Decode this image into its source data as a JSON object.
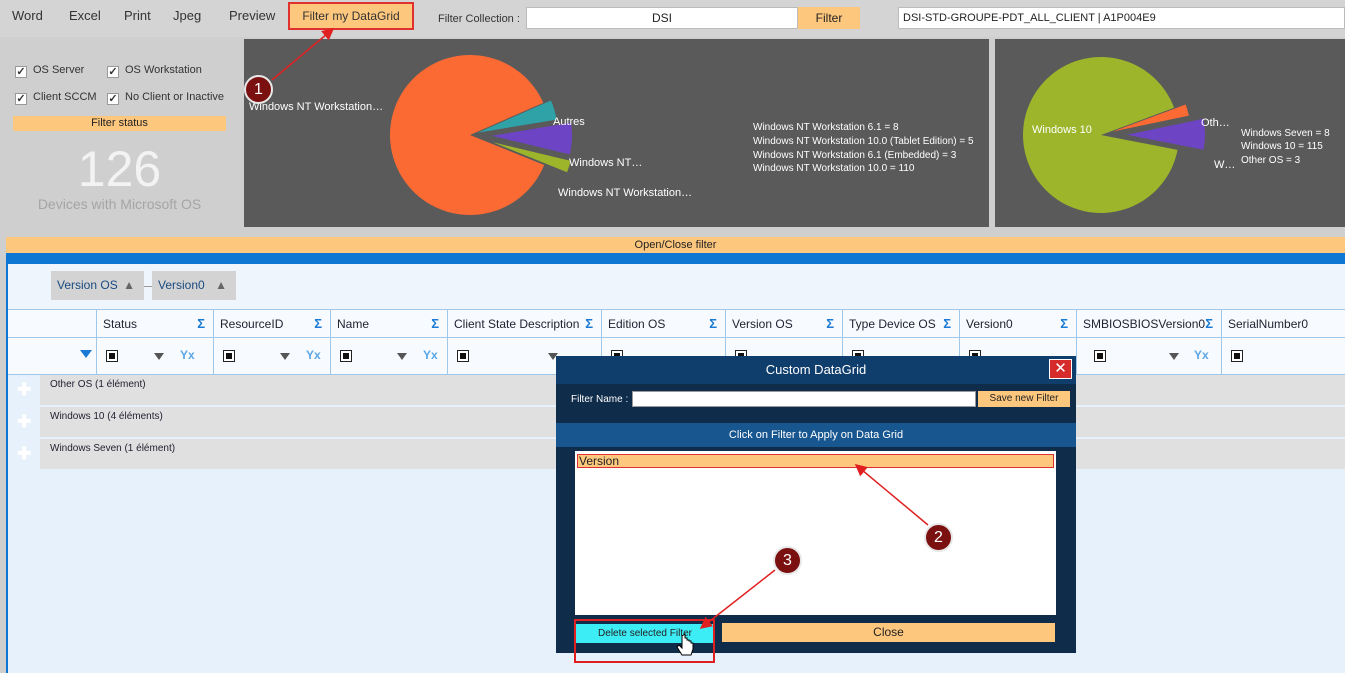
{
  "toolbar": {
    "word": "Word",
    "excel": "Excel",
    "print": "Print",
    "jpeg": "Jpeg",
    "preview": "Preview",
    "filter_grid": "Filter my DataGrid",
    "filter_collection_label": "Filter Collection :",
    "filter_collection_value": "DSI",
    "filter_button": "Filter",
    "collection_select": "DSI-STD-GROUPE-PDT_ALL_CLIENT  |  A1P004E9"
  },
  "options": {
    "os_server": "OS Server",
    "os_workstation": "OS Workstation",
    "client_sccm": "Client SCCM",
    "no_client": "No Client or Inactive",
    "filter_status": "Filter status",
    "count": "126",
    "count_label": "Devices with Microsoft OS"
  },
  "colors": {
    "orange": "#fc6a34",
    "teal": "#2fa2a8",
    "purple": "#6d44c4",
    "green": "#9db52a",
    "accent": "#fdc77e",
    "blue": "#0e77d4"
  },
  "chart_data": [
    {
      "type": "pie",
      "labels": [
        "Windows NT Workstation…",
        "Autres",
        "Windows NT…",
        "Windows NT Workstation…"
      ],
      "legend": [
        "Windows NT Workstation 6.1 = 8",
        "Windows NT Workstation 10.0 (Tablet Edition) = 5",
        "Windows NT Workstation 6.1 (Embedded) = 3",
        "Windows NT Workstation 10.0 = 110"
      ],
      "slices": [
        {
          "name": "Windows NT Workstation 10.0",
          "value": 110
        },
        {
          "name": "Windows NT Workstation 10.0 (Tablet Edition)",
          "value": 5
        },
        {
          "name": "Windows NT Workstation 6.1",
          "value": 8
        },
        {
          "name": "Windows NT Workstation 6.1 (Embedded)",
          "value": 3
        }
      ]
    },
    {
      "type": "pie",
      "labels": [
        "Windows 10",
        "Oth…",
        "W…"
      ],
      "legend": [
        "Windows Seven = 8",
        "Windows 10 = 115",
        "Other OS = 3"
      ],
      "slices": [
        {
          "name": "Windows 10",
          "value": 115
        },
        {
          "name": "Other OS",
          "value": 3
        },
        {
          "name": "Windows Seven",
          "value": 8
        }
      ]
    }
  ],
  "open_close": "Open/Close filter",
  "group_chips": [
    "Version OS",
    "Version0"
  ],
  "columns": [
    "Status",
    "ResourceID",
    "Name",
    "Client State Description",
    "Edition OS",
    "Version OS",
    "Type Device OS",
    "Version0",
    "SMBIOSBIOSVersion0",
    "SerialNumber0"
  ],
  "groups": [
    "Other OS (1 élément)",
    "Windows 10 (4 éléments)",
    "Windows Seven (1 élément)"
  ],
  "dialog": {
    "title": "Custom DataGrid",
    "close": "✕",
    "filter_name_label": "Filter Name :",
    "save": "Save new Filter",
    "band": "Click on Filter to Apply on Data Grid",
    "item": "Version",
    "delete": "Delete selected Filter",
    "close_button": "Close"
  },
  "annotations": [
    "1",
    "2",
    "3"
  ]
}
